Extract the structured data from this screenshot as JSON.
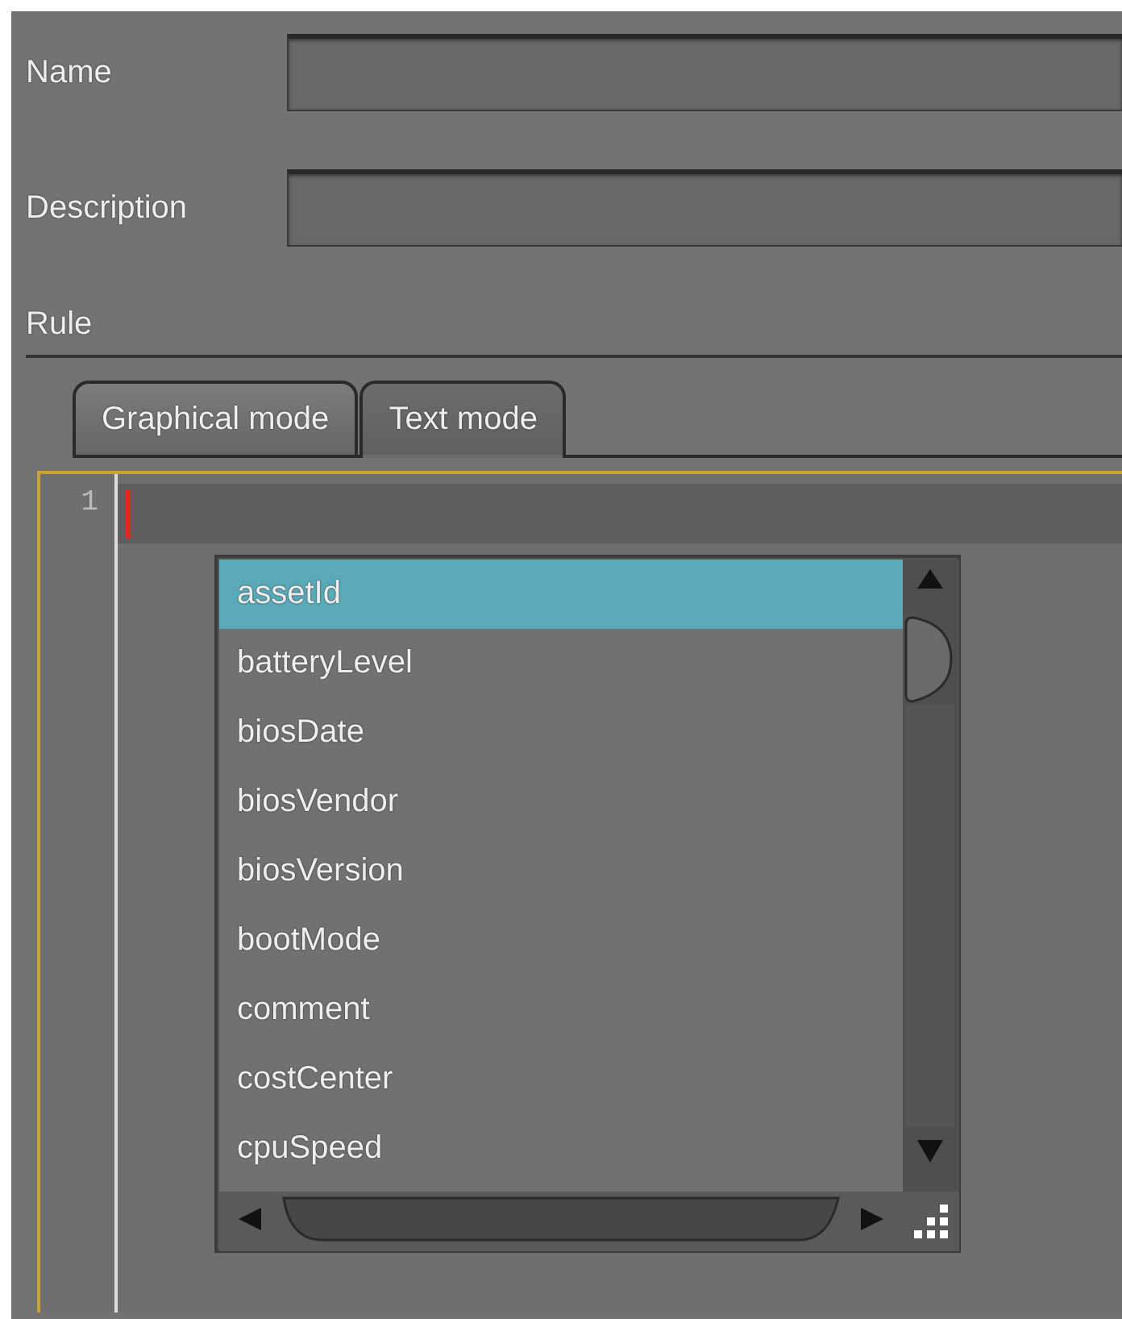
{
  "fields": [
    {
      "label": "Name"
    },
    {
      "label": "Description"
    }
  ],
  "section_label": "Rule",
  "tabs": [
    {
      "label": "Graphical mode",
      "selected": false
    },
    {
      "label": "Text mode",
      "selected": true
    }
  ],
  "editor": {
    "line_numbers": [
      "1"
    ],
    "completion": {
      "items": [
        {
          "label": "assetId",
          "selected": true
        },
        {
          "label": "batteryLevel",
          "selected": false
        },
        {
          "label": "biosDate",
          "selected": false
        },
        {
          "label": "biosVendor",
          "selected": false
        },
        {
          "label": "biosVersion",
          "selected": false
        },
        {
          "label": "bootMode",
          "selected": false
        },
        {
          "label": "comment",
          "selected": false
        },
        {
          "label": "costCenter",
          "selected": false
        },
        {
          "label": "cpuSpeed",
          "selected": false
        }
      ]
    }
  }
}
